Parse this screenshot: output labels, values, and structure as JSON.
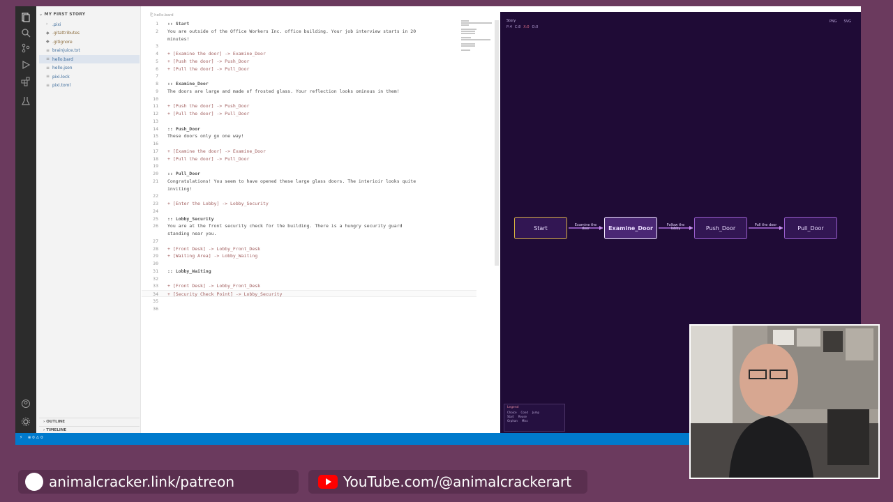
{
  "explorer": {
    "header": "MY FIRST STORY",
    "files": [
      {
        "name": ".pixi",
        "kind": "folder"
      },
      {
        "name": ".gitattributes",
        "kind": "dot"
      },
      {
        "name": ".gitignore",
        "kind": "dot"
      },
      {
        "name": "brainjuice.txt",
        "kind": "file"
      },
      {
        "name": "hello.bard",
        "kind": "file",
        "selected": true
      },
      {
        "name": "hello.json",
        "kind": "file"
      },
      {
        "name": "pixi.lock",
        "kind": "file"
      },
      {
        "name": "pixi.toml",
        "kind": "file"
      }
    ],
    "outline_label": "OUTLINE",
    "timeline_label": "TIMELINE"
  },
  "editor": {
    "breadcrumb": "hello.bard",
    "lines": [
      {
        "n": "1",
        "text": ":: Start",
        "type": "passage"
      },
      {
        "n": "2",
        "text": "You are outside of the Office Workers Inc. office building. Your job interview starts in 20",
        "type": "text"
      },
      {
        "n": "",
        "text": "minutes!",
        "type": "text"
      },
      {
        "n": "3",
        "text": "",
        "type": "text"
      },
      {
        "n": "4",
        "text": "+ [Examine the door] -> Examine_Door",
        "type": "link"
      },
      {
        "n": "5",
        "text": "+ [Push the door] -> Push_Door",
        "type": "link"
      },
      {
        "n": "6",
        "text": "+ [Pull the door] -> Pull_Door",
        "type": "link"
      },
      {
        "n": "7",
        "text": "",
        "type": "text"
      },
      {
        "n": "8",
        "text": ":: Examine_Door",
        "type": "passage"
      },
      {
        "n": "9",
        "text": "The doors are large and made of frosted glass. Your reflection looks ominous in them!",
        "type": "text"
      },
      {
        "n": "10",
        "text": "",
        "type": "text"
      },
      {
        "n": "11",
        "text": "+ [Push the door] -> Push_Door",
        "type": "link"
      },
      {
        "n": "12",
        "text": "+ [Pull the door] -> Pull_Door",
        "type": "link"
      },
      {
        "n": "13",
        "text": "",
        "type": "text"
      },
      {
        "n": "14",
        "text": ":: Push_Door",
        "type": "passage"
      },
      {
        "n": "15",
        "text": "These doors only go one way!",
        "type": "text"
      },
      {
        "n": "16",
        "text": "",
        "type": "text"
      },
      {
        "n": "17",
        "text": "+ [Examine the door] -> Examine_Door",
        "type": "link"
      },
      {
        "n": "18",
        "text": "+ [Pull the door] -> Pull_Door",
        "type": "link"
      },
      {
        "n": "19",
        "text": "",
        "type": "text"
      },
      {
        "n": "20",
        "text": ":: Pull_Door",
        "type": "passage"
      },
      {
        "n": "21",
        "text": "Congratulations! You seem to have opened these large glass doors. The interioir looks quite",
        "type": "text"
      },
      {
        "n": "",
        "text": "inviting!",
        "type": "text"
      },
      {
        "n": "22",
        "text": "",
        "type": "text"
      },
      {
        "n": "23",
        "text": "+ [Enter the Lobby] -> Lobby_Security",
        "type": "link"
      },
      {
        "n": "24",
        "text": "",
        "type": "text"
      },
      {
        "n": "25",
        "text": ":: Lobby_Security",
        "type": "passage"
      },
      {
        "n": "26",
        "text": "You are at the front security check for the building. There is a hungry security guard",
        "type": "text"
      },
      {
        "n": "",
        "text": "standing near you.",
        "type": "text"
      },
      {
        "n": "27",
        "text": "",
        "type": "text"
      },
      {
        "n": "28",
        "text": "+ [Front Desk] -> Lobby_Front_Desk",
        "type": "link"
      },
      {
        "n": "29",
        "text": "+ [Waiting Area] -> Lobby_Waiting",
        "type": "link"
      },
      {
        "n": "30",
        "text": "",
        "type": "text"
      },
      {
        "n": "31",
        "text": ":: Lobby_Waiting",
        "type": "passage"
      },
      {
        "n": "32",
        "text": "",
        "type": "text"
      },
      {
        "n": "33",
        "text": "+ [Front Desk] -> Lobby_Front_Desk",
        "type": "link"
      },
      {
        "n": "34",
        "text": "+ [Security Check Point] -> Lobby_Security",
        "type": "link",
        "current": true
      },
      {
        "n": "35",
        "text": "",
        "type": "text"
      },
      {
        "n": "36",
        "text": "",
        "type": "text"
      }
    ]
  },
  "story_map": {
    "tab_label": "Story",
    "stats": [
      {
        "text": "P:4",
        "tone": "normal"
      },
      {
        "text": "C:8",
        "tone": "normal"
      },
      {
        "text": "X:0",
        "tone": "red"
      },
      {
        "text": "O:0",
        "tone": "normal"
      }
    ],
    "export_buttons": [
      "PNG",
      "SVG"
    ],
    "nodes": [
      {
        "label": "Start",
        "kind": "start"
      },
      {
        "label": "Examine_Door",
        "kind": "selected"
      },
      {
        "label": "Push_Door",
        "kind": "normal"
      },
      {
        "label": "Pull_Door",
        "kind": "normal"
      }
    ],
    "edge_labels": [
      "Examine the door",
      "Follow the lobby",
      "Pull the door"
    ],
    "legend": {
      "title": "Legend",
      "row1": [
        "Choice",
        "Cond",
        "Jump"
      ],
      "row2": [
        "Start",
        "Reuse"
      ],
      "row3": [
        "Orphan",
        "Miss"
      ]
    }
  },
  "statusbar": {
    "items": [
      "⚡",
      "⊗ 0 ⚠ 0"
    ]
  },
  "banners": {
    "patreon": "animalcracker.link/patreon",
    "youtube": "YouTube.com/@animalcrackerart"
  },
  "colors": {
    "background": "#6b3a5e",
    "map_background": "#1f0b36",
    "node_border": "#9b5fcf",
    "start_border": "#d8b340",
    "statusbar": "#007acc"
  }
}
